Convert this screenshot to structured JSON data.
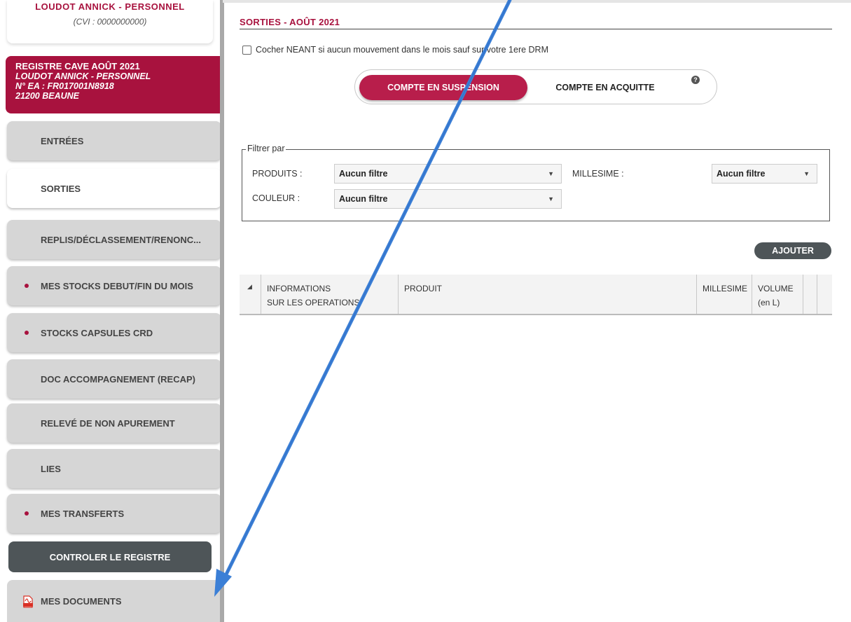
{
  "header": {
    "name": "LOUDOT ANNICK - PERSONNEL",
    "cvi": "(CVI : 0000000000)"
  },
  "registre": {
    "title": "REGISTRE CAVE AOÛT 2021",
    "name": "LOUDOT ANNICK - PERSONNEL",
    "ea": "N° EA : FR017001N8918",
    "city": "21200 BEAUNE"
  },
  "nav": {
    "entrees": "ENTRÉES",
    "sorties": "SORTIES",
    "replis": "REPLIS/DÉCLASSEMENT/RENONC...",
    "stocks": "MES STOCKS DEBUT/FIN DU MOIS",
    "capsules": "STOCKS CAPSULES CRD",
    "doc": "DOC ACCOMPAGNEMENT (RECAP)",
    "releve": "RELEVÉ DE NON APUREMENT",
    "lies": "LIES",
    "transferts": "MES TRANSFERTS",
    "controler": "CONTROLER LE REGISTRE",
    "documents": "MES DOCUMENTS"
  },
  "main": {
    "title": "SORTIES - AOÛT 2021",
    "neant_label": "Cocher NEANT si aucun mouvement dans le mois sauf sur votre 1ere DRM",
    "toggle_suspension": "COMPTE EN SUSPENSION",
    "toggle_acquitte": "COMPTE EN ACQUITTE",
    "help": "?"
  },
  "filter": {
    "legend": "Filtrer par",
    "produits_label": "PRODUITS :",
    "produits_value": "Aucun filtre",
    "millesime_label": "MILLESIME :",
    "millesime_value": "Aucun filtre",
    "couleur_label": "COULEUR :",
    "couleur_value": "Aucun filtre"
  },
  "actions": {
    "ajouter": "AJOUTER"
  },
  "table": {
    "col_info_line1": "INFORMATIONS",
    "col_info_line2": "SUR LES OPERATIONS",
    "col_produit": "PRODUIT",
    "col_millesime": "MILLESIME",
    "col_volume_line1": "VOLUME",
    "col_volume_line2": "(en L)"
  },
  "colors": {
    "brand": "#a8123e",
    "dark": "#4e5558",
    "annotation_arrow": "#3b7fd6"
  }
}
